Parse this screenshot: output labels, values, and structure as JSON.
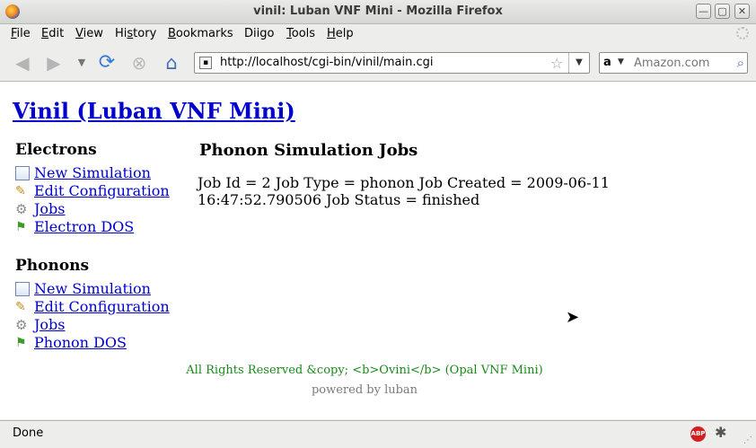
{
  "window": {
    "title": "vinil: Luban VNF Mini - Mozilla Firefox",
    "min_glyph": "—",
    "max_glyph": "▢",
    "close_glyph": "✕"
  },
  "menu": [
    {
      "first": "F",
      "rest": "ile"
    },
    {
      "first": "E",
      "rest": "dit"
    },
    {
      "first": "V",
      "rest": "iew"
    },
    {
      "first": "Hi",
      "rest": "s",
      "tail": "tory"
    },
    {
      "first": "B",
      "rest": "ookmarks"
    },
    {
      "first": "",
      "rest": "Diigo"
    },
    {
      "first": "T",
      "rest": "ools"
    },
    {
      "first": "H",
      "rest": "elp"
    }
  ],
  "menu_labels": [
    "File",
    "Edit",
    "View",
    "History",
    "Bookmarks",
    "Diigo",
    "Tools",
    "Help"
  ],
  "toolbar": {
    "url": "http://localhost/cgi-bin/vinil/main.cgi",
    "search_placeholder": "Amazon.com",
    "search_engine": "a"
  },
  "icons": {
    "back": "back-arrow-icon",
    "forward": "forward-arrow-icon",
    "reload": "reload-icon",
    "stop": "stop-icon",
    "home": "home-icon",
    "bookmark_star": "star-icon",
    "search_go": "magnifier-icon"
  },
  "page": {
    "site_title": "Vinil (Luban VNF Mini)",
    "sections": [
      {
        "heading": "Electrons",
        "items": [
          "New Simulation",
          "Edit Configuration",
          "Jobs",
          "Electron DOS"
        ]
      },
      {
        "heading": "Phonons",
        "items": [
          "New Simulation",
          "Edit Configuration",
          "Jobs",
          "Phonon DOS"
        ]
      }
    ],
    "main_heading": "Phonon Simulation Jobs",
    "job_line": "Job Id = 2 Job Type = phonon Job Created = 2009-06-11 16:47:52.790506 Job Status = finished",
    "footer_rights": "All Rights Reserved &copy; <b>Ovini</b> (Opal VNF Mini)",
    "footer_powered": "powered by luban"
  },
  "statusbar": {
    "status": "Done",
    "abp_label": "ABP"
  },
  "colors": {
    "link": "#0000cc",
    "footer_green": "#1a8a1a",
    "chrome_bg": "#ededeb"
  }
}
